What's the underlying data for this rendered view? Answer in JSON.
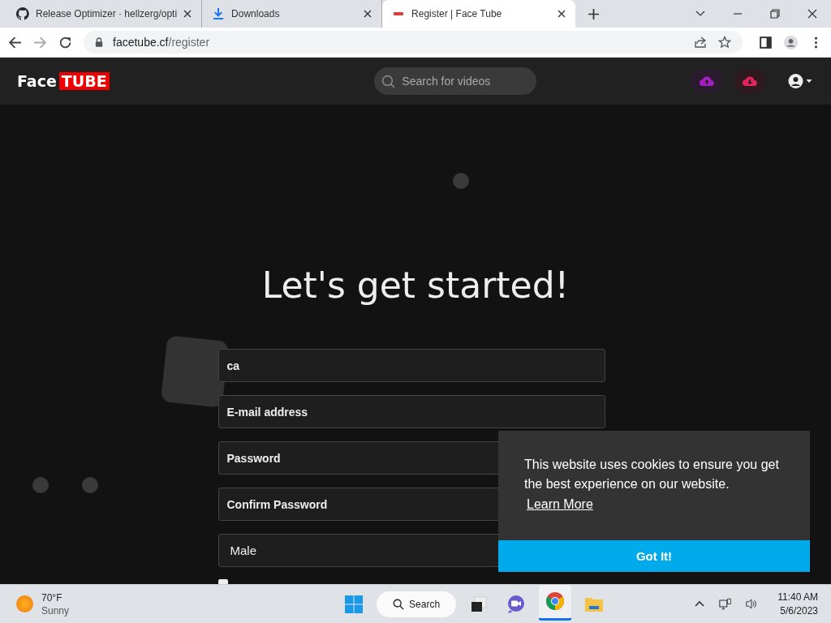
{
  "browser": {
    "tabs": [
      {
        "title": "Release Optimizer · hellzerg/opti",
        "selected": false
      },
      {
        "title": "Downloads",
        "selected": false
      },
      {
        "title": "Register | Face Tube",
        "selected": true
      }
    ],
    "url_host": "facetube.cf",
    "url_path": "/register"
  },
  "site": {
    "logo": {
      "part_1": "Face",
      "part_2": "TUBE"
    },
    "search": {
      "placeholder": "Search for videos"
    }
  },
  "form": {
    "heading": "Let's get started!",
    "fields": [
      {
        "kind": "text",
        "value": "ca"
      },
      {
        "kind": "text",
        "placeholder": "E-mail address"
      },
      {
        "kind": "password",
        "placeholder": "Password"
      },
      {
        "kind": "password",
        "placeholder": "Confirm Password"
      },
      {
        "kind": "select",
        "value": "Male"
      }
    ],
    "terms_checkbox": {
      "checked": false
    }
  },
  "cookie_banner": {
    "message": "This website uses cookies to ensure you get the best experience on our website.",
    "link": "Learn More",
    "button": "Got It!"
  },
  "taskbar": {
    "weather": {
      "temperature": "70°F",
      "condition": "Sunny"
    },
    "search": "Search",
    "time": "11:40 AM",
    "date": "5/6/2023"
  }
}
